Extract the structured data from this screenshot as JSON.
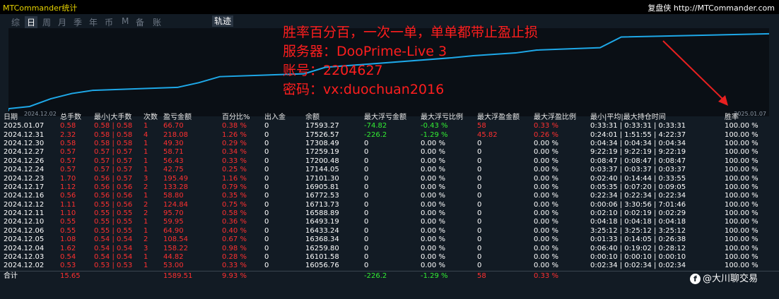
{
  "app_title": "MTCommander统计",
  "right_title": "复盘侠 http://MTCommander.com",
  "periods": [
    "综",
    "日",
    "周",
    "月",
    "季",
    "年",
    "币",
    "M",
    "备",
    "账户"
  ],
  "active_period": "日",
  "track_label": "轨迹",
  "annotation_lines": [
    "胜率百分百，一次一单，单单都带止盈止损",
    "服务器：DooPrime-Live 3",
    "账号：2204627",
    "密码：vx:duochuan2016"
  ],
  "colors": {
    "line": "#1ea8e8",
    "profit": "#ff3030",
    "loss": "#33ee33",
    "text": "#ffffff",
    "annotation": "#ff1e1e"
  },
  "chart_data": {
    "type": "line",
    "x": [
      "2024.12.02",
      "2024.12.03",
      "2024.12.04",
      "2024.12.05",
      "2024.12.06",
      "2024.12.10",
      "2024.12.11",
      "2024.12.12",
      "2024.12.16",
      "2024.12.17",
      "2024.12.23",
      "2024.12.24",
      "2024.12.26",
      "2024.12.27",
      "2024.12.30",
      "2024.12.31",
      "2025.01.07"
    ],
    "values": [
      16056.76,
      16101.58,
      16259.8,
      16368.34,
      16433.24,
      16493.19,
      16588.89,
      16713.73,
      16772.53,
      16905.81,
      17101.3,
      17144.05,
      17200.48,
      17259.19,
      17308.49,
      17526.57,
      17593.27
    ],
    "x_tick_labels": [
      "2024.12.02",
      "2025.01.07"
    ]
  },
  "table": {
    "columns": [
      "日期",
      "总手数",
      "最小|大手数",
      "次数",
      "盈亏金额",
      "百分比%",
      "出入金",
      "余额",
      "最大浮亏金额",
      "最大浮亏比例",
      "最大浮盈金额",
      "最大浮盈比例",
      "最小|平均|最大持仓时间",
      "胜率"
    ],
    "rows": [
      [
        "2025.01.07",
        "0.58",
        "0.58 | 0.58",
        "1",
        "66.70",
        "0.38 %",
        "0",
        "17593.27",
        "-74.82",
        "-0.43 %",
        "58",
        "0.33 %",
        "0:33:31 | 0:33:31 | 0:33:31",
        "100.00 %"
      ],
      [
        "2024.12.31",
        "2.32",
        "0.58 | 0.58",
        "4",
        "218.08",
        "1.26 %",
        "0",
        "17526.57",
        "-226.2",
        "-1.29 %",
        "45.82",
        "0.26 %",
        "0:24:01 | 1:51:55 | 4:22:37",
        "100.00 %"
      ],
      [
        "2024.12.30",
        "0.58",
        "0.58 | 0.58",
        "1",
        "49.30",
        "0.29 %",
        "0",
        "17308.49",
        "0",
        "0.00 %",
        "0",
        "0.00 %",
        "0:04:34 | 0:04:34 | 0:04:34",
        "100.00 %"
      ],
      [
        "2024.12.27",
        "0.57",
        "0.57 | 0.57",
        "1",
        "58.71",
        "0.34 %",
        "0",
        "17259.19",
        "0",
        "0.00 %",
        "0",
        "0.00 %",
        "9:22:19 | 9:22:19 | 9:22:19",
        "100.00 %"
      ],
      [
        "2024.12.26",
        "0.57",
        "0.57 | 0.57",
        "1",
        "56.43",
        "0.33 %",
        "0",
        "17200.48",
        "0",
        "0.00 %",
        "0",
        "0.00 %",
        "0:08:47 | 0:08:47 | 0:08:47",
        "100.00 %"
      ],
      [
        "2024.12.24",
        "0.57",
        "0.57 | 0.57",
        "1",
        "42.75",
        "0.25 %",
        "0",
        "17144.05",
        "0",
        "0.00 %",
        "0",
        "0.00 %",
        "0:03:37 | 0:03:37 | 0:03:37",
        "100.00 %"
      ],
      [
        "2024.12.23",
        "1.70",
        "0.56 | 0.57",
        "3",
        "195.49",
        "1.16 %",
        "0",
        "17101.30",
        "0",
        "0.00 %",
        "0",
        "0.00 %",
        "0:02:40 | 0:14:44 | 0:33:55",
        "100.00 %"
      ],
      [
        "2024.12.17",
        "1.12",
        "0.56 | 0.56",
        "2",
        "133.28",
        "0.79 %",
        "0",
        "16905.81",
        "0",
        "0.00 %",
        "0",
        "0.00 %",
        "0:05:35 | 0:07:20 | 0:09:05",
        "100.00 %"
      ],
      [
        "2024.12.16",
        "0.56",
        "0.56 | 0.56",
        "1",
        "58.80",
        "0.35 %",
        "0",
        "16772.53",
        "0",
        "0.00 %",
        "0",
        "0.00 %",
        "0:22:34 | 0:22:34 | 0:22:34",
        "100.00 %"
      ],
      [
        "2024.12.12",
        "1.11",
        "0.55 | 0.56",
        "2",
        "124.84",
        "0.75 %",
        "0",
        "16713.73",
        "0",
        "0.00 %",
        "0",
        "0.00 %",
        "0:00:06 | 3:30:56 | 7:01:46",
        "100.00 %"
      ],
      [
        "2024.12.11",
        "1.10",
        "0.55 | 0.55",
        "2",
        "95.70",
        "0.58 %",
        "0",
        "16588.89",
        "0",
        "0.00 %",
        "0",
        "0.00 %",
        "0:02:10 | 0:02:19 | 0:02:29",
        "100.00 %"
      ],
      [
        "2024.12.10",
        "0.55",
        "0.55 | 0.55",
        "1",
        "59.95",
        "0.36 %",
        "0",
        "16493.19",
        "0",
        "0.00 %",
        "0",
        "0.00 %",
        "0:04:18 | 0:04:18 | 0:04:18",
        "100.00 %"
      ],
      [
        "2024.12.06",
        "0.55",
        "0.55 | 0.55",
        "1",
        "64.90",
        "0.40 %",
        "0",
        "16433.24",
        "0",
        "0.00 %",
        "0",
        "0.00 %",
        "3:25:12 | 3:25:12 | 3:25:12",
        "100.00 %"
      ],
      [
        "2024.12.05",
        "1.08",
        "0.54 | 0.54",
        "2",
        "108.54",
        "0.67 %",
        "0",
        "16368.34",
        "0",
        "0.00 %",
        "0",
        "0.00 %",
        "0:01:33 | 0:14:05 | 0:26:38",
        "100.00 %"
      ],
      [
        "2024.12.04",
        "1.62",
        "0.54 | 0.54",
        "3",
        "158.22",
        "0.98 %",
        "0",
        "16259.80",
        "0",
        "0.00 %",
        "0",
        "0.00 %",
        "0:06:40 | 0:19:02 | 0:28:12",
        "100.00 %"
      ],
      [
        "2024.12.03",
        "0.54",
        "0.54 | 0.54",
        "1",
        "44.82",
        "0.28 %",
        "0",
        "16101.58",
        "0",
        "0.00 %",
        "0",
        "0.00 %",
        "0:00:10 | 0:00:10 | 0:00:10",
        "100.00 %"
      ],
      [
        "2024.12.02",
        "0.53",
        "0.53 | 0.53",
        "1",
        "53.00",
        "0.33 %",
        "0",
        "16056.76",
        "0",
        "0.00 %",
        "0",
        "0.00 %",
        "0:02:34 | 0:02:34 | 0:02:34",
        "100.00 %"
      ]
    ],
    "total": [
      "合计",
      "15.65",
      "",
      "",
      "1589.51",
      "9.93 %",
      "",
      "",
      "-226.2",
      "-1.29 %",
      "58",
      "0.33 %",
      "",
      ""
    ]
  },
  "watermark": "@大川聊交易"
}
